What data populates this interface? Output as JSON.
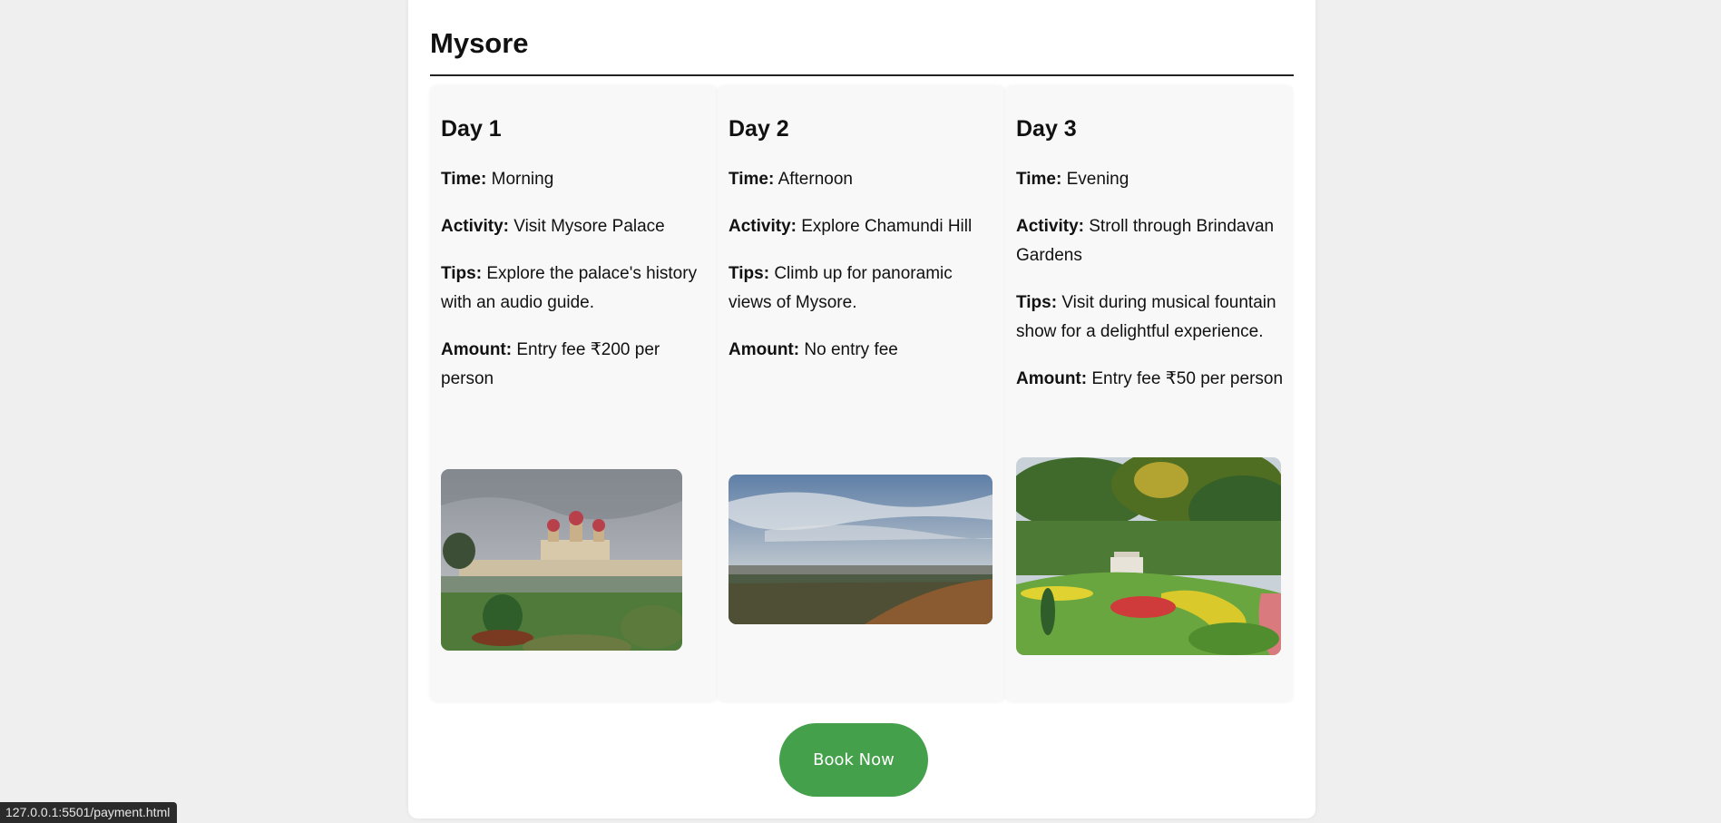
{
  "city": "Mysore",
  "days": [
    {
      "title": "Day 1",
      "time_label": "Time:",
      "time": "Morning",
      "activity_label": "Activity:",
      "activity": "Visit Mysore Palace",
      "tips_label": "Tips:",
      "tips": "Explore the palace's history with an audio guide.",
      "amount_label": "Amount:",
      "amount": "Entry fee ₹200 per person",
      "image_alt": "Mysore Palace"
    },
    {
      "title": "Day 2",
      "time_label": "Time:",
      "time": "Afternoon",
      "activity_label": "Activity:",
      "activity": "Explore Chamundi Hill",
      "tips_label": "Tips:",
      "tips": "Climb up for panoramic views of Mysore.",
      "amount_label": "Amount:",
      "amount": "No entry fee",
      "image_alt": "Chamundi Hill view"
    },
    {
      "title": "Day 3",
      "time_label": "Time:",
      "time": "Evening",
      "activity_label": "Activity:",
      "activity": "Stroll through Brindavan Gardens",
      "tips_label": "Tips:",
      "tips": "Visit during musical fountain show for a delightful experience.",
      "amount_label": "Amount:",
      "amount": "Entry fee ₹50 per person",
      "image_alt": "Brindavan Gardens"
    }
  ],
  "book_button": "Book Now",
  "status_bar_url": "127.0.0.1:5501/payment.html",
  "colors": {
    "button": "#44a04a",
    "card": "#f8f8f8",
    "page": "#efefef"
  }
}
